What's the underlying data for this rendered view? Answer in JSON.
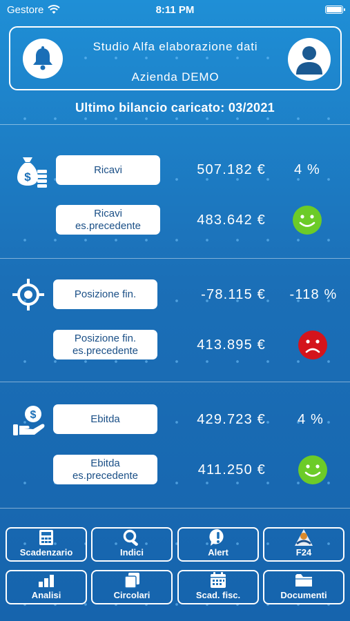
{
  "status_bar": {
    "carrier": "Gestore",
    "time": "8:11 PM"
  },
  "header": {
    "title": "Studio Alfa elaborazione dati",
    "company": "Azienda DEMO",
    "last_balance": "Ultimo bilancio caricato: 03/2021"
  },
  "sections": {
    "ricavi": {
      "icon": "money-bag-icon",
      "current_label": "Ricavi",
      "current_value": "507.182 €",
      "percent": "4 %",
      "previous_label": "Ricavi\nes.precedente",
      "previous_value": "483.642 €",
      "status": "good"
    },
    "posizione": {
      "icon": "target-icon",
      "current_label": "Posizione fin.",
      "current_value": "-78.115 €",
      "percent": "-118 %",
      "previous_label": "Posizione fin.\nes.precedente",
      "previous_value": "413.895 €",
      "status": "bad"
    },
    "ebitda": {
      "icon": "hand-coin-icon",
      "current_label": "Ebitda",
      "current_value": "429.723 €",
      "percent": "4 %",
      "previous_label": "Ebitda\nes.precedente",
      "previous_value": "411.250 €",
      "status": "good"
    }
  },
  "nav": {
    "scadenzario": "Scadenzario",
    "indici": "Indici",
    "alert": "Alert",
    "f24": "F24",
    "analisi": "Analisi",
    "circolari": "Circolari",
    "scad_fisc": "Scad. fisc.",
    "documenti": "Documenti"
  },
  "colors": {
    "good": "#6ccb28",
    "bad": "#d4141c",
    "label_text": "#1a4f86"
  }
}
